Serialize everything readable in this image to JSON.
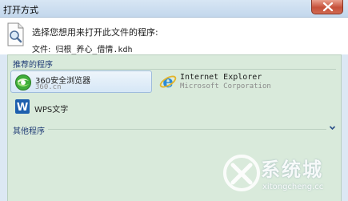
{
  "window": {
    "title": "打开方式"
  },
  "header": {
    "prompt": "选择您想用来打开此文件的程序:",
    "file_label": "文件:",
    "file_name": "归根_养心_借情.kdh"
  },
  "recommended": {
    "label": "推荐的程序",
    "items": [
      {
        "name": "360安全浏览器",
        "desc": "360.cn",
        "icon": "browser-360-icon",
        "selected": true
      },
      {
        "name": "Internet Explorer",
        "desc": "Microsoft Corporation",
        "icon": "internet-explorer-icon",
        "selected": false
      },
      {
        "name": "WPS文字",
        "desc": "",
        "icon": "wps-writer-icon",
        "selected": false
      }
    ]
  },
  "other": {
    "label": "其他程序",
    "icon": "chevron-down-icon"
  },
  "watermark": {
    "text": "系统城",
    "sub": "xitongcheng.cc"
  },
  "colors": {
    "accent": "#1f3b75",
    "panel_bg": "#d9eadb",
    "close_red": "#c6513a"
  }
}
